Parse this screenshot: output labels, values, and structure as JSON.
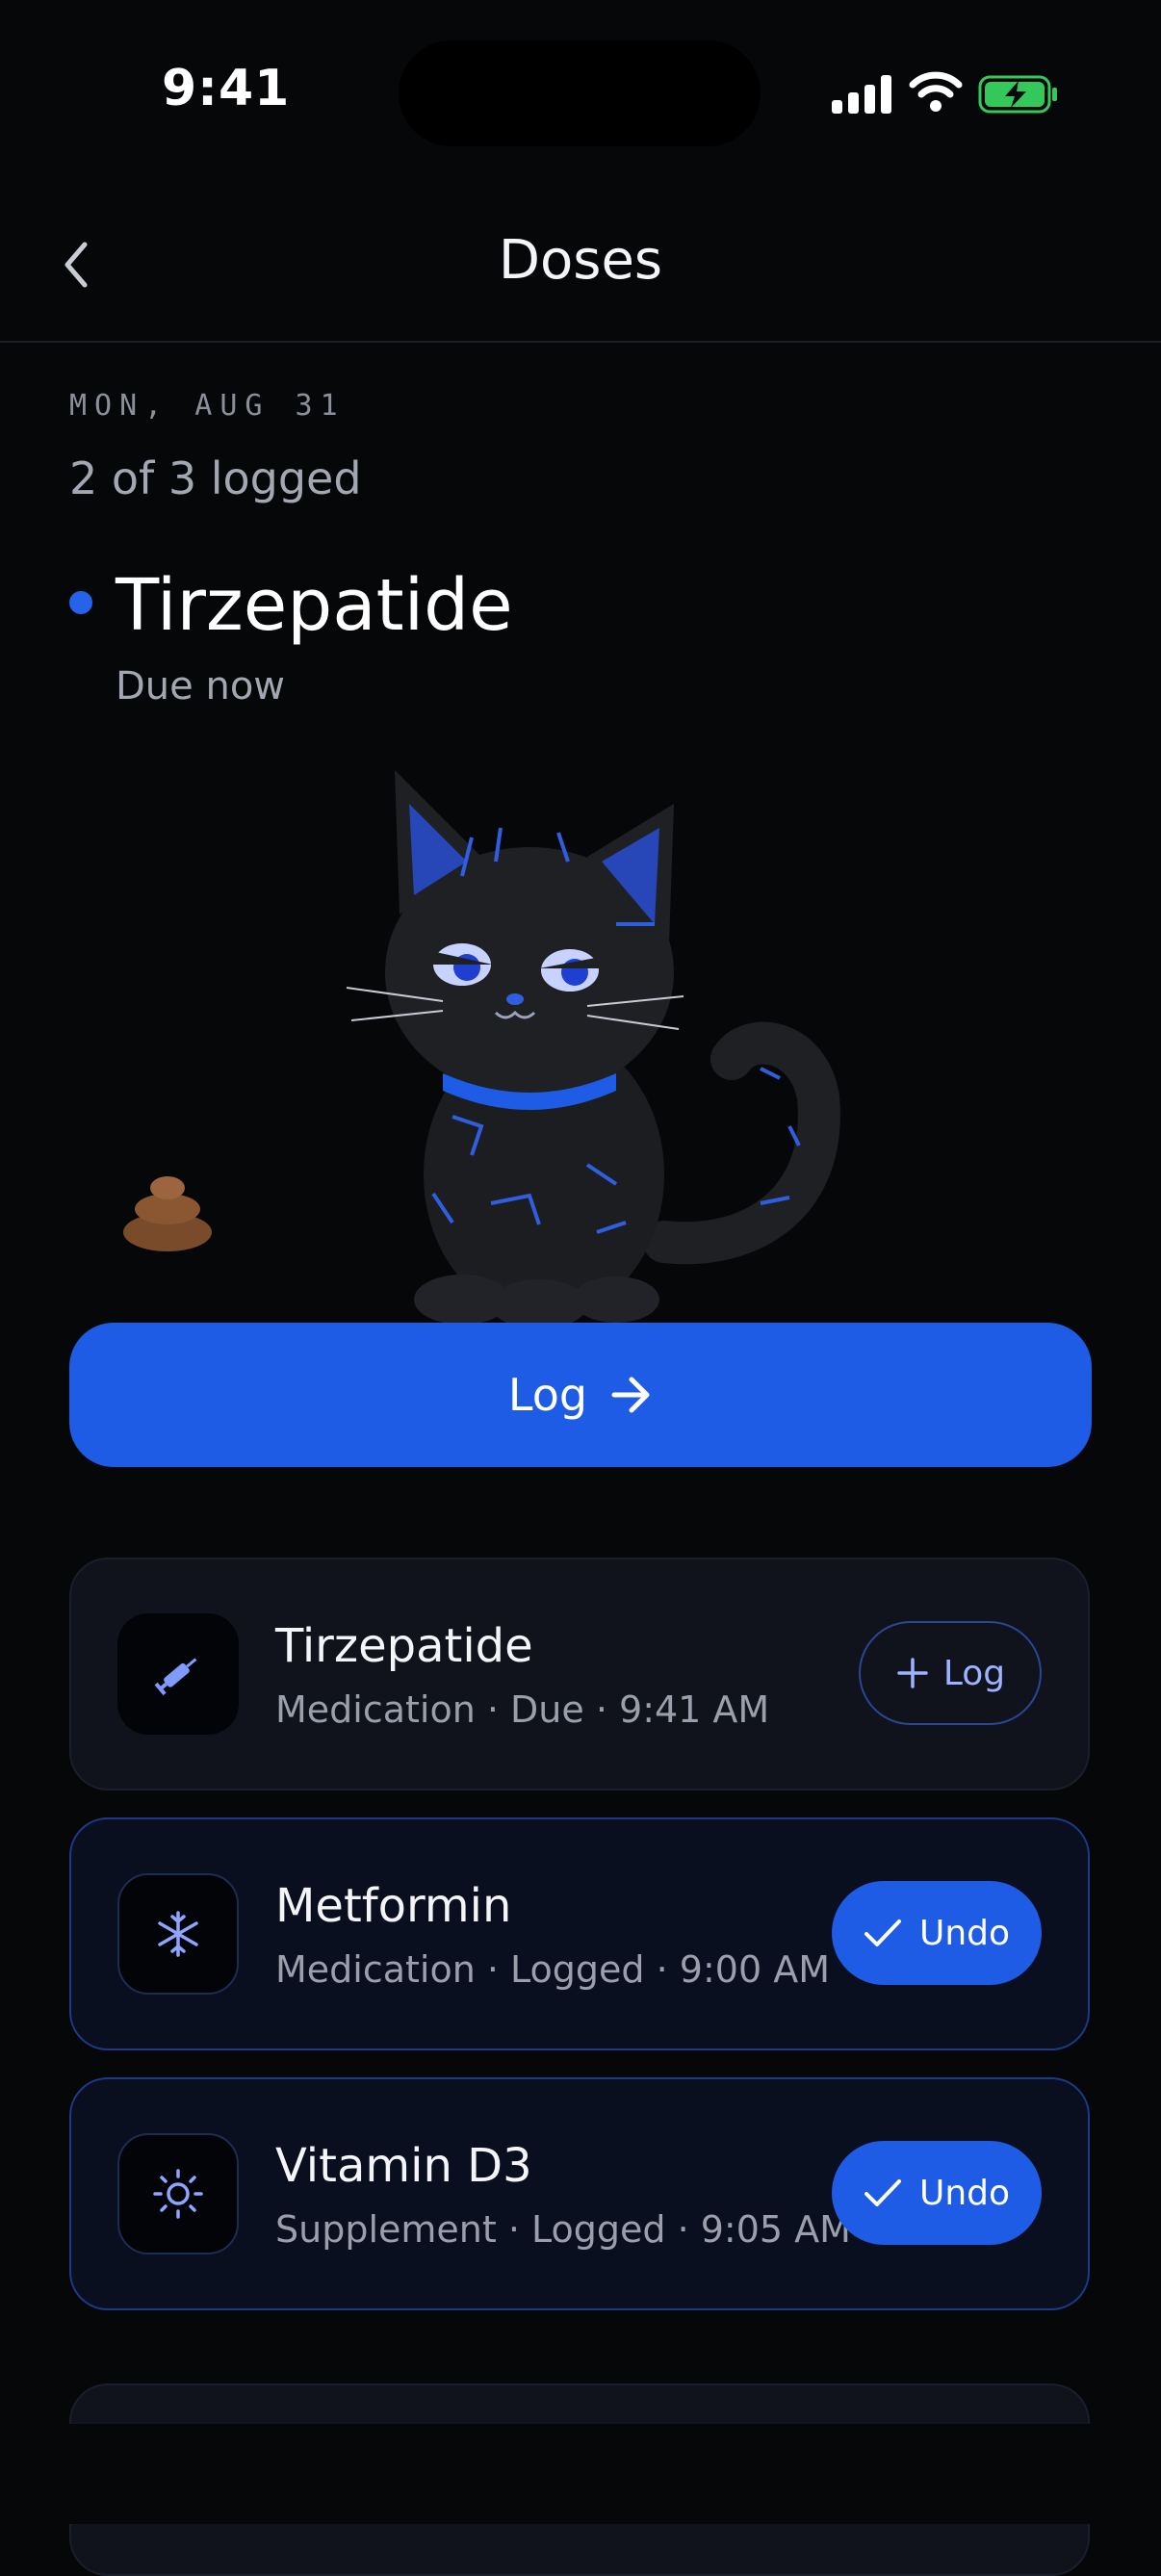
{
  "status_bar": {
    "time": "9:41"
  },
  "nav": {
    "title": "Doses"
  },
  "summary": {
    "date": "MON, AUG 31",
    "logged_count": "2 of 3 logged"
  },
  "hero": {
    "name": "Tirzepatide",
    "status": "Due now"
  },
  "primary_action": {
    "label": "Log"
  },
  "doses": [
    {
      "name": "Tirzepatide",
      "detail": "Medication · Due · 9:41 AM",
      "icon": "syringe-icon",
      "action": "Log"
    },
    {
      "name": "Metformin",
      "detail": "Medication · Logged · 9:00 AM",
      "icon": "snowflake-icon",
      "action": "Undo"
    },
    {
      "name": "Vitamin D3",
      "detail": "Supplement · Logged · 9:05 AM",
      "icon": "sun-icon",
      "action": "Undo"
    }
  ],
  "colors": {
    "accent": "#1e5ce6",
    "background": "#060709",
    "card": "#10131c",
    "battery": "#34c759"
  }
}
